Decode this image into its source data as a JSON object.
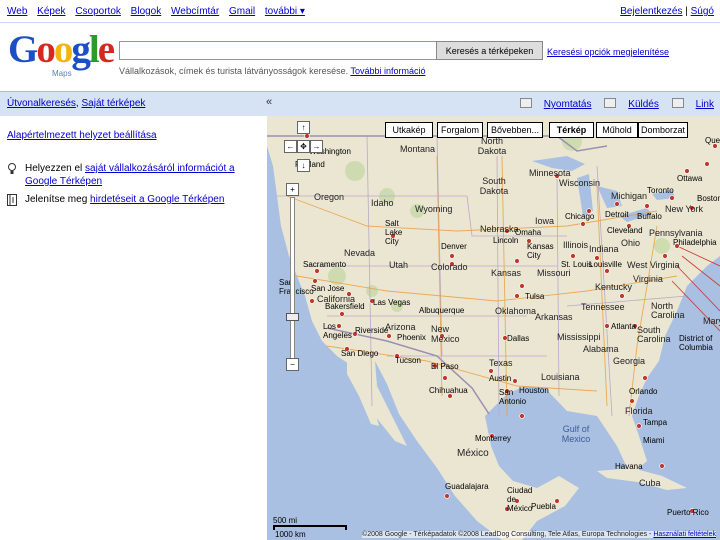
{
  "topnav": {
    "left": [
      "Web",
      "Képek",
      "Csoportok",
      "Blogok",
      "Webcímtár",
      "Gmail",
      "további ▾"
    ],
    "current_index": -1,
    "signin": "Bejelentkezés",
    "help": "Súgó"
  },
  "logo": {
    "word": "Google",
    "sub": "Maps"
  },
  "search": {
    "value": "",
    "button": "Keresés a térképeken",
    "options": "Keresési opciók megjelenítése",
    "hint_prefix": "Vállalkozások, címek és turista látványosságok keresése.",
    "hint_link": "További információ"
  },
  "tabs": {
    "directions": "Útvonalkeresés",
    "my_maps": "Saját térképek"
  },
  "collapse": "«",
  "actions": {
    "print": "Nyomtatás",
    "send": "Küldés",
    "link": "Link"
  },
  "sidebar": {
    "default_view": "Alapértelmezett helyzet beállítása",
    "item1_prefix": "Helyezzen el",
    "item1_link": "saját vállalkozásáról információt a Google Térképen",
    "item2_prefix": "Jelenítse meg",
    "item2_link": "hirdetéseit a Google Térképen"
  },
  "map_types": [
    "Utkakép",
    "Forgalom",
    "Bővebben...",
    "Térkép",
    "Műhold",
    "Domborzat"
  ],
  "map_type_selected": "Térkép",
  "scale": {
    "top": "500 mi",
    "bottom": "1000 km"
  },
  "copyright_prefix": "©2008 Google - Térképadatok ©2008 LeadDog Consulting, Tele Atlas, Europa Technologies - ",
  "copyright_link": "Használati feltételek",
  "map_labels": [
    {
      "text": "Montana",
      "k": "st"
    },
    {
      "text": "North Dakota",
      "k": "st"
    },
    {
      "text": "Minnesota",
      "k": "st"
    },
    {
      "text": "Washington",
      "k": "st"
    },
    {
      "text": "Portland",
      "k": ""
    },
    {
      "text": "Oregon",
      "k": "st"
    },
    {
      "text": "Idaho",
      "k": "st"
    },
    {
      "text": "Wyoming",
      "k": "st"
    },
    {
      "text": "South Dakota",
      "k": "st"
    },
    {
      "text": "Wisconsin",
      "k": "st"
    },
    {
      "text": "Michigan",
      "k": "st"
    },
    {
      "text": "Ottawa",
      "k": ""
    },
    {
      "text": "Toronto",
      "k": ""
    },
    {
      "text": "Boston",
      "k": ""
    },
    {
      "text": "Buffalo",
      "k": ""
    },
    {
      "text": "New York",
      "k": "st"
    },
    {
      "text": "Chicago",
      "k": ""
    },
    {
      "text": "Detroit",
      "k": ""
    },
    {
      "text": "Cleveland",
      "k": ""
    },
    {
      "text": "Pennsylvania",
      "k": "st"
    },
    {
      "text": "Philadelphia",
      "k": ""
    },
    {
      "text": "Salt Lake City",
      "k": ""
    },
    {
      "text": "Nevada",
      "k": "st"
    },
    {
      "text": "Nebraska",
      "k": "st"
    },
    {
      "text": "Iowa",
      "k": "st"
    },
    {
      "text": "Omaha",
      "k": ""
    },
    {
      "text": "Lincoln",
      "k": ""
    },
    {
      "text": "Illinois",
      "k": "st"
    },
    {
      "text": "Indiana",
      "k": "st"
    },
    {
      "text": "Ohio",
      "k": "st"
    },
    {
      "text": "Denver",
      "k": ""
    },
    {
      "text": "Utah",
      "k": "st"
    },
    {
      "text": "Colorado",
      "k": "st"
    },
    {
      "text": "Kansas City",
      "k": ""
    },
    {
      "text": "Sacramento",
      "k": ""
    },
    {
      "text": "San Francisco",
      "k": ""
    },
    {
      "text": "San Jose",
      "k": ""
    },
    {
      "text": "California",
      "k": "st"
    },
    {
      "text": "Kansas",
      "k": "st"
    },
    {
      "text": "Missouri",
      "k": "st"
    },
    {
      "text": "St. Louis",
      "k": ""
    },
    {
      "text": "Louisville",
      "k": ""
    },
    {
      "text": "Kentucky",
      "k": "st"
    },
    {
      "text": "West Virginia",
      "k": "st"
    },
    {
      "text": "Virginia",
      "k": "st"
    },
    {
      "text": "Bakersfield",
      "k": ""
    },
    {
      "text": "Las Vegas",
      "k": ""
    },
    {
      "text": "Albuquerque",
      "k": ""
    },
    {
      "text": "Tulsa",
      "k": ""
    },
    {
      "text": "Oklahoma",
      "k": "st"
    },
    {
      "text": "Arkansas",
      "k": "st"
    },
    {
      "text": "Tennessee",
      "k": "st"
    },
    {
      "text": "North Carolina",
      "k": "st"
    },
    {
      "text": "Los Angeles",
      "k": ""
    },
    {
      "text": "Riverside",
      "k": ""
    },
    {
      "text": "Arizona",
      "k": "st"
    },
    {
      "text": "Phoenix",
      "k": ""
    },
    {
      "text": "New Mexico",
      "k": "st"
    },
    {
      "text": "Atlanta",
      "k": ""
    },
    {
      "text": "South Carolina",
      "k": "st"
    },
    {
      "text": "Mississippi",
      "k": "st"
    },
    {
      "text": "Alabama",
      "k": "st"
    },
    {
      "text": "San Diego",
      "k": ""
    },
    {
      "text": "Tucson",
      "k": ""
    },
    {
      "text": "Dallas",
      "k": ""
    },
    {
      "text": "District of Columbia",
      "k": ""
    },
    {
      "text": "El Paso",
      "k": ""
    },
    {
      "text": "Texas",
      "k": "st"
    },
    {
      "text": "Louisiana",
      "k": "st"
    },
    {
      "text": "Georgia",
      "k": "st"
    },
    {
      "text": "Chihuahua",
      "k": ""
    },
    {
      "text": "Austin",
      "k": ""
    },
    {
      "text": "San Antonio",
      "k": ""
    },
    {
      "text": "Houston",
      "k": ""
    },
    {
      "text": "Orlando",
      "k": ""
    },
    {
      "text": "Florida",
      "k": "st"
    },
    {
      "text": "Tampa",
      "k": ""
    },
    {
      "text": "Miami",
      "k": ""
    },
    {
      "text": "Monterrey",
      "k": ""
    },
    {
      "text": "Gulf of Mexico",
      "k": "ocean"
    },
    {
      "text": "México",
      "k": "ctry"
    },
    {
      "text": "Guadalajara",
      "k": ""
    },
    {
      "text": "Ciudad de México",
      "k": ""
    },
    {
      "text": "Puebla",
      "k": ""
    },
    {
      "text": "Havana",
      "k": ""
    },
    {
      "text": "Cuba",
      "k": "st"
    },
    {
      "text": "Puerto Rico",
      "k": ""
    },
    {
      "text": "Maryland",
      "k": "st"
    },
    {
      "text": "Quebec",
      "k": ""
    }
  ],
  "colors": {
    "water": "#a9c0e2",
    "land": "#ebe6d2",
    "accent": "#d6e3f5",
    "link": "#0000cc"
  }
}
